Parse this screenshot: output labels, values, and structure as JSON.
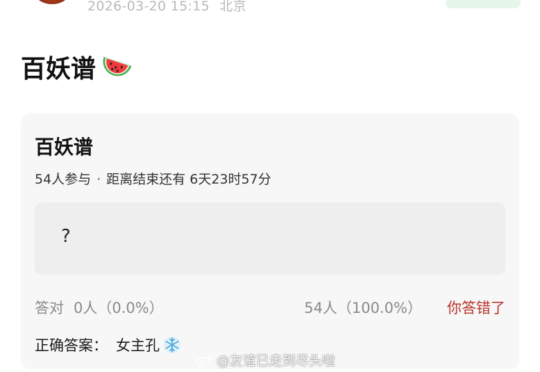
{
  "header": {
    "timestamp": "2026-03-20 15:15",
    "location": "北京"
  },
  "post": {
    "title": "百妖谱",
    "title_emoji": "watermelon-icon"
  },
  "poll": {
    "title": "百妖谱",
    "participants": "54人参与",
    "separator": "·",
    "countdown": "距离结束还有 6天23时57分",
    "option_text": "?",
    "correct_label": "答对",
    "correct_stat": "0人（0.0%）",
    "wrong_stat": "54人（100.0%）",
    "verdict": "你答错了",
    "answer_label": "正确答案：",
    "answer_value": "女主孔",
    "answer_emoji": "snowflake-icon"
  },
  "watermark": {
    "text": "@友谊已走到尽头啦",
    "icon": "weibo-icon"
  },
  "colors": {
    "card_bg": "#f7f7f7",
    "option_bg": "#eeeeee",
    "verdict_red": "#b8322a",
    "muted_text": "#8a8a8a",
    "meta_text": "#b9b9b9"
  }
}
